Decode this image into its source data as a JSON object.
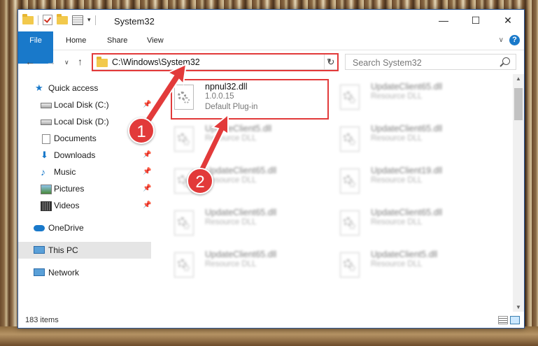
{
  "window": {
    "title": "System32"
  },
  "ribbon": {
    "tabs": [
      "File",
      "Home",
      "Share",
      "View"
    ]
  },
  "nav": {
    "address": "C:\\Windows\\System32",
    "search_placeholder": "Search System32"
  },
  "sidebar": {
    "items": [
      {
        "label": "Quick access",
        "icon": "star-icon"
      },
      {
        "label": "Local Disk (C:)",
        "icon": "disk-icon",
        "pinned": true
      },
      {
        "label": "Local Disk (D:)",
        "icon": "disk-icon",
        "pinned": true
      },
      {
        "label": "Documents",
        "icon": "documents-icon",
        "pinned": true
      },
      {
        "label": "Downloads",
        "icon": "download-icon",
        "pinned": true
      },
      {
        "label": "Music",
        "icon": "music-icon",
        "pinned": true
      },
      {
        "label": "Pictures",
        "icon": "pictures-icon",
        "pinned": true
      },
      {
        "label": "Videos",
        "icon": "video-icon",
        "pinned": true
      },
      {
        "label": "OneDrive",
        "icon": "cloud-icon"
      },
      {
        "label": "This PC",
        "icon": "computer-icon",
        "selected": true
      },
      {
        "label": "Network",
        "icon": "network-icon"
      }
    ]
  },
  "files": [
    {
      "name": "npnul32.dll",
      "version": "1.0.0.15",
      "type": "Default Plug-in"
    },
    {
      "name": "UpdateClient65.dll",
      "type": "Resource DLL"
    },
    {
      "name": "UpdateClient5.dll",
      "type": "Resource DLL"
    },
    {
      "name": "UpdateClient65.dll",
      "type": "Resource DLL"
    },
    {
      "name": "UpdateClient65.dll",
      "type": "Resource DLL"
    },
    {
      "name": "UpdateClient19.dll",
      "type": "Resource DLL"
    },
    {
      "name": "UpdateClient65.dll",
      "type": "Resource DLL"
    },
    {
      "name": "UpdateClient65.dll",
      "type": "Resource DLL"
    },
    {
      "name": "UpdateClient65.dll",
      "type": "Resource DLL"
    },
    {
      "name": "UpdateClient5.dll",
      "type": "Resource DLL"
    }
  ],
  "status": {
    "items": "183 items"
  },
  "annotations": {
    "step1": "1",
    "step2": "2"
  },
  "colors": {
    "accent": "#1979ca",
    "highlight": "#e23a3a",
    "selection": "#cce8ff"
  }
}
